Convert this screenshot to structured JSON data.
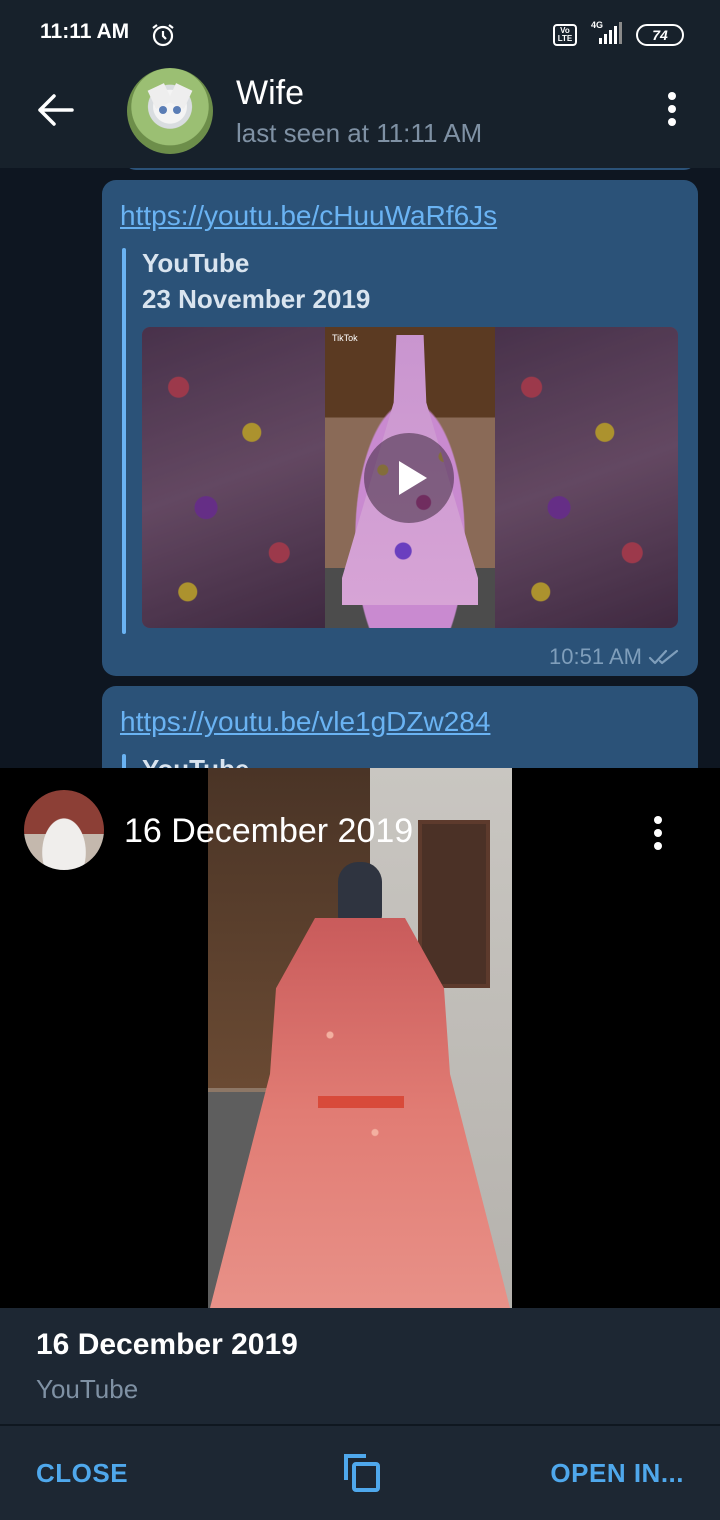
{
  "status_bar": {
    "time": "11:11 AM",
    "network": "4G",
    "volte": "Vo LTE",
    "battery": "74",
    "icons": [
      "alarm-icon",
      "volte-icon",
      "signal-icon",
      "battery-icon"
    ]
  },
  "header": {
    "title": "Wife",
    "subtitle": "last seen at 11:11 AM"
  },
  "messages": [
    {
      "link": "https://youtu.be/cHuuWaRf6Js",
      "site": "YouTube",
      "date": "23 November 2019",
      "time": "10:51 AM",
      "thumb_label": "TikTok"
    },
    {
      "link": "https://youtu.be/vle1gDZw284",
      "site": "YouTube"
    }
  ],
  "video_popup": {
    "date": "16 December 2019"
  },
  "info_panel": {
    "title": "16 December 2019",
    "subtitle": "YouTube"
  },
  "actions": {
    "close_label": "CLOSE",
    "open_label": "OPEN IN..."
  },
  "colors": {
    "accent": "#4fa8ec",
    "link": "#6ab3f3",
    "bubble": "#2b5278",
    "background": "#0e1621",
    "header": "#17212b"
  }
}
